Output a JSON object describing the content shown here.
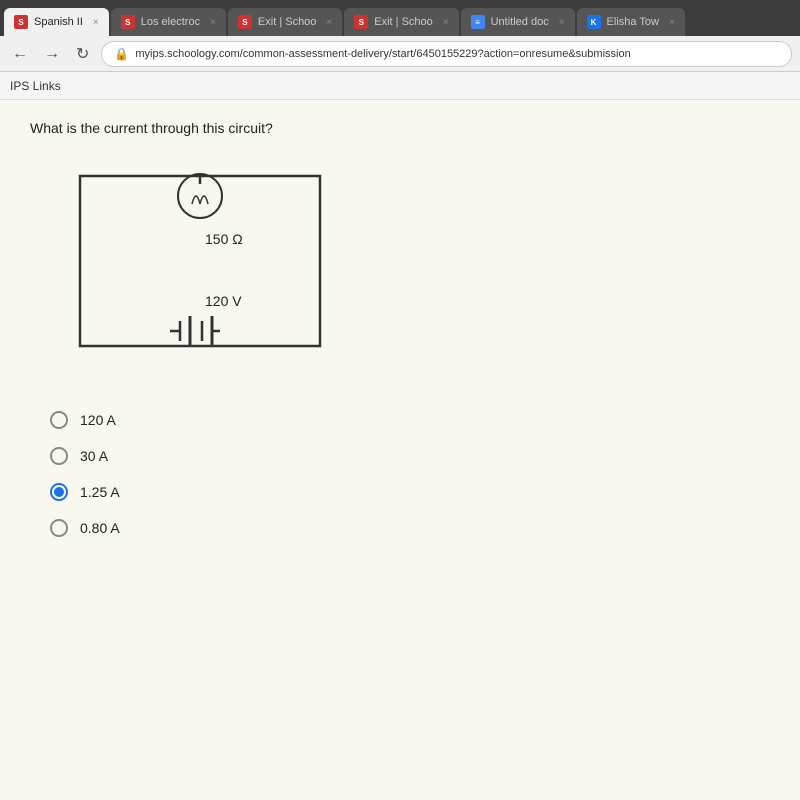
{
  "browser": {
    "tabs": [
      {
        "id": "t1",
        "label": "Spanish II",
        "favicon": "S",
        "faviconColor": "schoology",
        "active": true
      },
      {
        "id": "t2",
        "label": "Los electroc",
        "favicon": "S",
        "faviconColor": "schoology",
        "active": false
      },
      {
        "id": "t3",
        "label": "Exit | Schoo",
        "favicon": "S",
        "faviconColor": "schoology",
        "active": false
      },
      {
        "id": "t4",
        "label": "Exit | Schoo",
        "favicon": "S",
        "faviconColor": "schoology",
        "active": false
      },
      {
        "id": "t5",
        "label": "Untitled doc",
        "favicon": "≡",
        "faviconColor": "blue-doc",
        "active": false
      },
      {
        "id": "t6",
        "label": "Elisha Tow",
        "favicon": "K",
        "faviconColor": "k-logo",
        "active": false
      }
    ],
    "address": "myips.schoology.com/common-assessment-delivery/start/6450155229?action=onresume&submission",
    "bookmarks": [
      "IPS Links"
    ]
  },
  "question": {
    "text": "What is the current through this circuit?",
    "circuit": {
      "resistor_label": "150 Ω",
      "voltage_label": "120 V"
    },
    "options": [
      {
        "id": "a",
        "label": "120 A",
        "selected": false
      },
      {
        "id": "b",
        "label": "30 A",
        "selected": false
      },
      {
        "id": "c",
        "label": "1.25 A",
        "selected": true
      },
      {
        "id": "d",
        "label": "0.80 A",
        "selected": false
      }
    ]
  }
}
